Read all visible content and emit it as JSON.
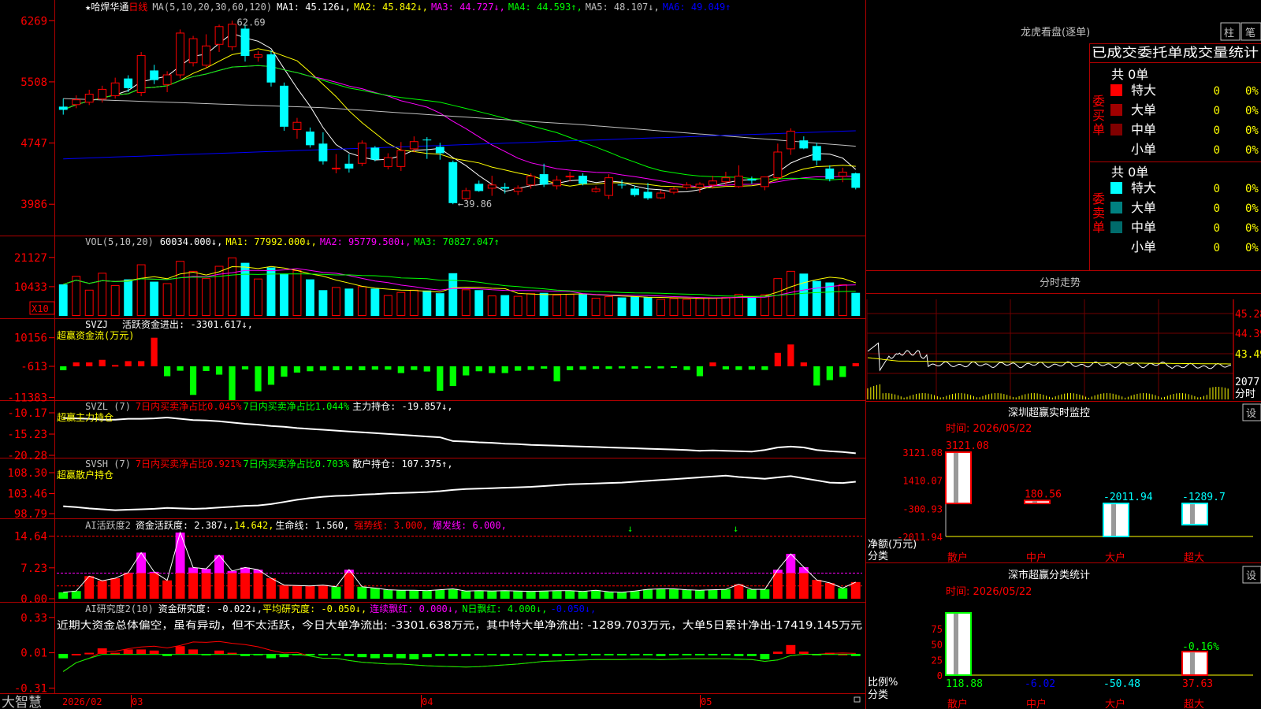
{
  "colors": {
    "up": "#ff0000",
    "down": "#00ffff",
    "green": "#00ff00",
    "yellow": "#ffff00",
    "magenta": "#ff00ff",
    "white": "#ffffff",
    "gray": "#c0c0c0",
    "blue": "#0000ff",
    "border": "#b00000",
    "dim": "#800000"
  },
  "kline": {
    "star": "★",
    "name": "哈焊华通",
    "period": "日线",
    "ma_label": "MA(5,10,20,30,60,120)",
    "ma1": "MA1: 45.126↓,",
    "ma2": "MA2: 45.842↓,",
    "ma3": "MA3: 44.727↓,",
    "ma4": "MA4: 44.593↑,",
    "ma5": "MA5: 48.107↓,",
    "ma6": "MA6: 49.049↑",
    "y_ticks": [
      "6269",
      "5508",
      "4747",
      "3986"
    ],
    "high_label": "62.69",
    "low_label": "←39.86",
    "high_value": 62.69,
    "low_value": 39.86,
    "candles": [
      {
        "o": 52.0,
        "h": 53.0,
        "l": 51.0,
        "c": 51.6
      },
      {
        "o": 52.3,
        "h": 53.4,
        "l": 51.8,
        "c": 52.9
      },
      {
        "o": 52.6,
        "h": 54.1,
        "l": 52.2,
        "c": 53.6
      },
      {
        "o": 53.0,
        "h": 54.6,
        "l": 52.5,
        "c": 54.2
      },
      {
        "o": 53.4,
        "h": 55.6,
        "l": 53.0,
        "c": 55.0
      },
      {
        "o": 55.5,
        "h": 55.9,
        "l": 53.8,
        "c": 54.3
      },
      {
        "o": 53.8,
        "h": 58.8,
        "l": 53.3,
        "c": 58.4
      },
      {
        "o": 56.5,
        "h": 57.2,
        "l": 54.8,
        "c": 55.3
      },
      {
        "o": 54.8,
        "h": 56.4,
        "l": 53.8,
        "c": 56.0
      },
      {
        "o": 56.0,
        "h": 61.6,
        "l": 55.5,
        "c": 61.2
      },
      {
        "o": 57.5,
        "h": 60.8,
        "l": 57.0,
        "c": 60.5
      },
      {
        "o": 57.2,
        "h": 61.0,
        "l": 56.8,
        "c": 59.6
      },
      {
        "o": 59.8,
        "h": 62.2,
        "l": 58.8,
        "c": 62.0
      },
      {
        "o": 59.5,
        "h": 62.69,
        "l": 59.0,
        "c": 62.3
      },
      {
        "o": 61.7,
        "h": 62.2,
        "l": 57.6,
        "c": 58.3
      },
      {
        "o": 58.2,
        "h": 58.9,
        "l": 57.6,
        "c": 58.5
      },
      {
        "o": 58.5,
        "h": 59.0,
        "l": 54.5,
        "c": 55.0
      },
      {
        "o": 54.6,
        "h": 55.0,
        "l": 49.0,
        "c": 49.5
      },
      {
        "o": 49.2,
        "h": 50.6,
        "l": 48.0,
        "c": 50.1
      },
      {
        "o": 48.9,
        "h": 49.4,
        "l": 46.9,
        "c": 47.2
      },
      {
        "o": 47.4,
        "h": 48.8,
        "l": 44.8,
        "c": 45.2
      },
      {
        "o": 44.3,
        "h": 46.1,
        "l": 43.7,
        "c": 44.4
      },
      {
        "o": 44.9,
        "h": 46.1,
        "l": 43.8,
        "c": 44.3
      },
      {
        "o": 45.0,
        "h": 47.8,
        "l": 44.6,
        "c": 47.5
      },
      {
        "o": 46.9,
        "h": 47.1,
        "l": 45.2,
        "c": 45.4
      },
      {
        "o": 44.6,
        "h": 46.2,
        "l": 44.2,
        "c": 45.7
      },
      {
        "o": 44.6,
        "h": 47.6,
        "l": 44.0,
        "c": 46.6
      },
      {
        "o": 46.8,
        "h": 48.3,
        "l": 46.3,
        "c": 47.7
      },
      {
        "o": 47.9,
        "h": 48.2,
        "l": 45.5,
        "c": 47.8
      },
      {
        "o": 47.0,
        "h": 47.5,
        "l": 45.4,
        "c": 46.2
      },
      {
        "o": 45.1,
        "h": 45.3,
        "l": 39.86,
        "c": 40.0
      },
      {
        "o": 40.6,
        "h": 41.9,
        "l": 40.3,
        "c": 41.6
      },
      {
        "o": 42.4,
        "h": 42.8,
        "l": 41.4,
        "c": 41.5
      },
      {
        "o": 41.9,
        "h": 43.4,
        "l": 40.9,
        "c": 42.3
      },
      {
        "o": 42.0,
        "h": 42.5,
        "l": 41.2,
        "c": 41.8
      },
      {
        "o": 41.5,
        "h": 42.2,
        "l": 41.0,
        "c": 41.9
      },
      {
        "o": 42.3,
        "h": 43.7,
        "l": 41.8,
        "c": 43.4
      },
      {
        "o": 43.6,
        "h": 44.9,
        "l": 42.0,
        "c": 42.3
      },
      {
        "o": 42.2,
        "h": 43.4,
        "l": 41.7,
        "c": 42.9
      },
      {
        "o": 43.4,
        "h": 43.9,
        "l": 42.7,
        "c": 43.4
      },
      {
        "o": 43.4,
        "h": 43.7,
        "l": 42.2,
        "c": 42.4
      },
      {
        "o": 41.5,
        "h": 42.1,
        "l": 41.3,
        "c": 41.8
      },
      {
        "o": 41.0,
        "h": 43.6,
        "l": 40.5,
        "c": 43.2
      },
      {
        "o": 42.3,
        "h": 42.9,
        "l": 41.8,
        "c": 42.2
      },
      {
        "o": 41.8,
        "h": 42.2,
        "l": 40.8,
        "c": 41.0
      },
      {
        "o": 41.4,
        "h": 42.5,
        "l": 40.4,
        "c": 40.6
      },
      {
        "o": 40.7,
        "h": 41.6,
        "l": 40.5,
        "c": 41.3
      },
      {
        "o": 41.4,
        "h": 42.0,
        "l": 41.1,
        "c": 41.8
      },
      {
        "o": 42.0,
        "h": 42.6,
        "l": 41.7,
        "c": 42.3
      },
      {
        "o": 42.0,
        "h": 42.6,
        "l": 41.3,
        "c": 42.4
      },
      {
        "o": 42.3,
        "h": 43.4,
        "l": 41.8,
        "c": 42.8
      },
      {
        "o": 42.7,
        "h": 43.9,
        "l": 42.1,
        "c": 43.2
      },
      {
        "o": 42.1,
        "h": 44.7,
        "l": 41.9,
        "c": 43.4
      },
      {
        "o": 43.0,
        "h": 43.3,
        "l": 42.4,
        "c": 42.8
      },
      {
        "o": 42.1,
        "h": 43.3,
        "l": 41.6,
        "c": 43.3
      },
      {
        "o": 43.2,
        "h": 47.4,
        "l": 42.8,
        "c": 46.4
      },
      {
        "o": 46.8,
        "h": 49.3,
        "l": 46.0,
        "c": 49.0
      },
      {
        "o": 47.8,
        "h": 48.3,
        "l": 46.7,
        "c": 46.8
      },
      {
        "o": 47.1,
        "h": 47.5,
        "l": 44.7,
        "c": 45.3
      },
      {
        "o": 44.3,
        "h": 44.7,
        "l": 42.7,
        "c": 43.0
      },
      {
        "o": 43.4,
        "h": 44.4,
        "l": 42.6,
        "c": 43.9
      },
      {
        "o": 43.7,
        "h": 43.8,
        "l": 41.7,
        "c": 41.9
      }
    ]
  },
  "vol": {
    "label": "VOL(5,10,20)",
    "v": "60034.000↓,",
    "ma1": "MA1: 77992.000↓,",
    "ma2": "MA2: 95779.500↓,",
    "ma3": "MA3: 70827.047↑",
    "y_ticks": [
      "21127",
      "10433"
    ],
    "unit": "X10",
    "values": [
      8.2,
      10.4,
      6.8,
      11.2,
      8.0,
      9.5,
      13.4,
      8.9,
      8.5,
      14.3,
      11.7,
      9.8,
      13.0,
      15.2,
      13.8,
      9.7,
      12.6,
      11.0,
      11.9,
      9.5,
      6.7,
      7.5,
      7.1,
      7.7,
      7.1,
      5.4,
      6.2,
      6.8,
      6.6,
      5.9,
      11.1,
      6.9,
      6.7,
      5.3,
      5.4,
      5.2,
      5.9,
      6.0,
      5.5,
      5.7,
      5.6,
      4.7,
      5.1,
      4.8,
      5.0,
      4.8,
      4.4,
      4.6,
      4.4,
      4.6,
      4.7,
      4.9,
      5.7,
      5.0,
      5.6,
      9.8,
      11.7,
      11.0,
      9.1,
      8.7,
      8.2,
      6.0
    ]
  },
  "svzj": {
    "label": "SVZJ",
    "a": "活跃资金进出: -3301.617↓,",
    "b": "超赢资金流(万元)",
    "y_ticks": [
      "10156",
      "-613",
      "-11383"
    ],
    "values": [
      -1.5,
      1.5,
      1.5,
      2.5,
      0.5,
      2.0,
      2.0,
      11.0,
      -3.8,
      -1.7,
      -11.0,
      -1.8,
      -3.2,
      -13.0,
      -1.2,
      -9.6,
      -7.1,
      -4.0,
      -2.4,
      -1.9,
      -1.6,
      -1.5,
      -1.4,
      -1.5,
      -1.3,
      -1.3,
      -2.6,
      -1.4,
      -2.0,
      -9.4,
      -7.6,
      -3.5,
      -1.9,
      -2.6,
      -2.6,
      -1.7,
      -1.4,
      -0.9,
      -5.8,
      -1.5,
      -1.3,
      -1.0,
      -1.0,
      -0.8,
      -0.9,
      -0.7,
      -0.8,
      -0.6,
      -1.4,
      -3.8,
      1.5,
      -1.2,
      -1.4,
      -1.3,
      -1.4,
      5.2,
      8.4,
      1.5,
      -7.4,
      -5.3,
      -4.1,
      1.2,
      -4.1
    ]
  },
  "svzl": {
    "label": "SVZL (7)",
    "a": "7日内买卖净占比0.045%",
    "b": "7日内买卖净占比1.044%",
    "c": "主力持仓: -19.857↓,",
    "d": "超赢主力持仓",
    "y_ticks": [
      "-10.17",
      "-15.23",
      "-20.28"
    ],
    "values": [
      -11.4,
      -11.5,
      -11.6,
      -11.8,
      -11.8,
      -11.6,
      -11.6,
      -11.5,
      -11.3,
      -11.6,
      -11.9,
      -12.0,
      -12.2,
      -12.5,
      -12.8,
      -13.0,
      -13.3,
      -13.5,
      -13.8,
      -14.0,
      -14.2,
      -14.4,
      -14.6,
      -14.8,
      -15.0,
      -15.2,
      -15.4,
      -15.6,
      -15.8,
      -16.0,
      -16.9,
      -17.0,
      -17.2,
      -17.3,
      -17.5,
      -17.6,
      -17.8,
      -17.9,
      -18.0,
      -18.1,
      -18.2,
      -18.3,
      -18.4,
      -18.5,
      -18.6,
      -18.7,
      -18.8,
      -18.9,
      -19.0,
      -19.2,
      -19.1,
      -19.2,
      -19.3,
      -19.4,
      -19.0,
      -18.4,
      -18.2,
      -18.4,
      -19.0,
      -19.3,
      -19.5,
      -19.8
    ]
  },
  "svsh": {
    "label": "SVSH (7)",
    "a": "7日内买卖净占比0.921%",
    "b": "7日内买卖净占比0.703%",
    "c": "散户持仓: 107.375↑,",
    "d": "超赢散户持仓",
    "y_ticks": [
      "108.30",
      "103.46",
      "98.79"
    ],
    "values": [
      100.5,
      100.3,
      100.0,
      99.8,
      99.6,
      99.7,
      99.8,
      99.9,
      100.1,
      100.0,
      99.9,
      100.0,
      100.2,
      100.4,
      100.6,
      100.7,
      101.0,
      101.5,
      102.0,
      102.4,
      102.7,
      102.9,
      103.0,
      103.2,
      103.3,
      103.5,
      103.6,
      103.7,
      103.8,
      104.0,
      104.3,
      104.5,
      104.6,
      104.7,
      104.8,
      104.9,
      105.0,
      105.2,
      105.4,
      105.6,
      105.7,
      105.8,
      105.9,
      106.0,
      106.2,
      106.4,
      106.6,
      106.8,
      107.0,
      107.2,
      107.4,
      107.6,
      107.3,
      107.1,
      106.9,
      107.2,
      107.5,
      107.0,
      106.5,
      106.0,
      105.9,
      106.2,
      106.6,
      107.0,
      107.4
    ]
  },
  "ai1": {
    "label": "AI活跃度2",
    "a": "资金活跃度: 2.387↓,",
    "b": "14.642,",
    "c": "生命线: 1.560,",
    "d": "强势线: 3.000,",
    "e": "爆发线: 6.000,",
    "y_ticks": [
      "14.64",
      "7.23",
      "0.00"
    ],
    "values": [
      1.5,
      1.8,
      5.3,
      4.2,
      4.8,
      6.1,
      10.8,
      6.3,
      4.3,
      15.5,
      7.3,
      7.0,
      10.2,
      6.5,
      7.3,
      6.8,
      4.8,
      3.2,
      3.1,
      3.0,
      3.2,
      2.8,
      6.8,
      2.8,
      2.5,
      2.1,
      2.0,
      2.0,
      1.9,
      2.1,
      2.3,
      1.8,
      1.9,
      1.8,
      1.9,
      1.8,
      1.7,
      1.8,
      1.9,
      1.9,
      1.7,
      2.0,
      1.6,
      1.5,
      1.8,
      2.2,
      2.3,
      2.3,
      2.1,
      2.0,
      2.1,
      2.2,
      3.4,
      2.2,
      2.2,
      6.8,
      10.5,
      7.4,
      4.4,
      3.7,
      2.5,
      3.9,
      2.4
    ],
    "strong_value": 3.0,
    "burst_value": 6.0,
    "top_value": 14.642,
    "arrow_1": "↓",
    "arrow_2": "↓"
  },
  "ai2": {
    "label": "AI研究度2(10)",
    "a": "资金研究度: -0.022↓,",
    "b": "平均研究度: -0.050↓,",
    "c": "连续飘红: 0.000↓,",
    "d": "N日飘红: 4.000↓,",
    "e": "-0.050↓,",
    "comment": "近期大资金总体偏空，虽有异动，但不太活跃，今日大单净流出: -3301.638万元，其中特大单净流出: -1289.703万元，大单5日累计净出-17419.145万元",
    "y_ticks": [
      "0.33",
      "0.01",
      "-0.31"
    ],
    "values": [
      -0.04,
      0.0,
      0.01,
      0.05,
      0.01,
      0.04,
      0.04,
      0.03,
      -0.02,
      0.07,
      0.04,
      -0.01,
      0.03,
      0.01,
      -0.02,
      -0.01,
      -0.04,
      -0.03,
      -0.01,
      -0.01,
      -0.01,
      -0.01,
      -0.02,
      -0.03,
      -0.04,
      -0.03,
      -0.04,
      -0.05,
      -0.03,
      -0.02,
      -0.02,
      -0.02,
      -0.01,
      -0.01,
      -0.02,
      -0.01,
      -0.01,
      -0.02,
      -0.02,
      -0.01,
      -0.01,
      -0.01,
      -0.01,
      -0.01,
      -0.01,
      -0.01,
      -0.02,
      -0.01,
      -0.01,
      -0.01,
      -0.01,
      -0.01,
      -0.02,
      -0.02,
      -0.05,
      0.02,
      0.08,
      0.02,
      -0.01,
      0.01,
      0.0,
      -0.02
    ]
  },
  "timeline": {
    "t0": "2026/02",
    "m1": "03",
    "m2": "04",
    "m3": "05"
  },
  "bottom": {
    "brand": "大智慧"
  },
  "right": {
    "lhb_title": "龙虎看盘(逐单)",
    "btn_zhu": "柱",
    "btn_bi": "笔",
    "table_header": "已成交委托单成交量统计",
    "buy_label": "委买单",
    "sell_label": "委卖单",
    "buy_total": "共 0单",
    "sell_total": "共 0单",
    "rows": [
      {
        "name": "特大",
        "v": "0",
        "p": "0%"
      },
      {
        "name": "大单",
        "v": "0",
        "p": "0%"
      },
      {
        "name": "中单",
        "v": "0",
        "p": "0%"
      },
      {
        "name": "小单",
        "v": "0",
        "p": "0%"
      }
    ],
    "fs_title": "分时走势",
    "fs_ticks": [
      "45.28",
      "44.39",
      "43.49",
      "2077"
    ],
    "fs_unit": "分时",
    "rt_title": "深圳超赢实时监控",
    "rt_time": "时间: 2026/05/22",
    "rt_ticks": [
      "3121.08",
      "1410.07",
      "-300.93",
      "-2011.94"
    ],
    "rt_ylabel": "净额(万元)",
    "rt_xlabel": "分类",
    "rt_bars": [
      {
        "cat": "散户",
        "value": 3121.08,
        "label": "3121.08"
      },
      {
        "cat": "中户",
        "value": 180.56,
        "label": "180.56"
      },
      {
        "cat": "大户",
        "value": -2011.94,
        "label": "-2011.94"
      },
      {
        "cat": "超大",
        "value": -1289.7,
        "label": "-1289.7"
      }
    ],
    "set_label": "设",
    "cls_title": "深市超赢分类统计",
    "cls_time": "时间: 2026/05/22",
    "cls_ticks": [
      "75",
      "50",
      "25",
      "0"
    ],
    "cls_ylabel": "比例%",
    "cls_xlabel": "分类",
    "cls_bars": [
      {
        "cat": "散户",
        "value": 118.88,
        "label": "118.88"
      },
      {
        "cat": "中户",
        "value": -6.02,
        "label": "-6.02"
      },
      {
        "cat": "大户",
        "value": -50.48,
        "label": "-50.48"
      },
      {
        "cat": "超大",
        "value": 37.63,
        "label": "37.63"
      }
    ],
    "cls_extra": "-0.16%"
  }
}
